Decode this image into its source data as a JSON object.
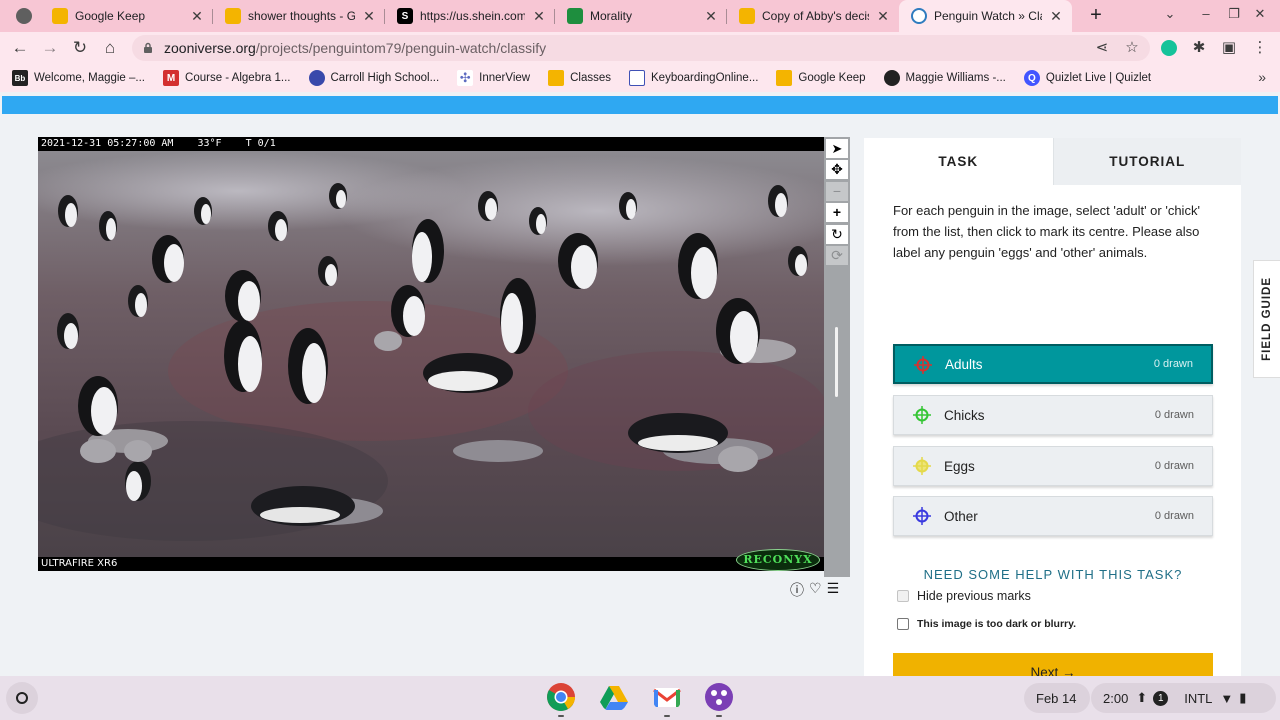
{
  "browser": {
    "tabs": [
      {
        "title": "Google Keep",
        "icon": "keep-icon",
        "color": "#f4b400",
        "active": false
      },
      {
        "title": "shower thoughts - Goo",
        "icon": "docs-icon",
        "color": "#f4b400",
        "active": false
      },
      {
        "title": "https://us.shein.com/a",
        "icon": "shein-icon",
        "color": "#000000",
        "active": false
      },
      {
        "title": "Morality",
        "icon": "classroom-icon",
        "color": "#1e8e3e",
        "active": false
      },
      {
        "title": "Copy of Abby's decisio",
        "icon": "slides-icon",
        "color": "#f4b400",
        "active": false
      },
      {
        "title": "Penguin Watch » Clas",
        "icon": "zooniverse-icon",
        "color": "#2f7cbf",
        "active": true
      }
    ],
    "url_host": "zooniverse.org",
    "url_path": "/projects/penguintom79/penguin-watch/classify",
    "bookmarks": [
      {
        "label": "Welcome, Maggie –...",
        "icon": "blackboard-icon",
        "color": "#222222",
        "glyph": "Bb"
      },
      {
        "label": "Course - Algebra 1...",
        "icon": "mcgraw-icon",
        "color": "#d32f2f",
        "glyph": "M"
      },
      {
        "label": "Carroll High School...",
        "icon": "school-icon",
        "color": "#3949ab",
        "glyph": ""
      },
      {
        "label": "InnerView",
        "icon": "innerview-icon",
        "color": "#5c6bc0",
        "glyph": ""
      },
      {
        "label": "Classes",
        "icon": "classroom-icon",
        "color": "#f4b400",
        "glyph": ""
      },
      {
        "label": "KeyboardingOnline...",
        "icon": "keyboarding-icon",
        "color": "#3f51b5",
        "glyph": ""
      },
      {
        "label": "Google Keep",
        "icon": "keep-icon",
        "color": "#f4b400",
        "glyph": ""
      },
      {
        "label": "Maggie Williams -...",
        "icon": "github-icon",
        "color": "#222222",
        "glyph": ""
      },
      {
        "label": "Quizlet Live | Quizlet",
        "icon": "quizlet-icon",
        "color": "#4255ff",
        "glyph": "Q"
      }
    ]
  },
  "viewer": {
    "timestamp": "2021-12-31 05:27:00 AM",
    "temperature": "33°F",
    "trigger": "T 0/1",
    "camera_model": "ULTRAFIRE XR6",
    "brand": "RECONYX"
  },
  "panel": {
    "tab_task": "TASK",
    "tab_tutorial": "TUTORIAL",
    "instructions": "For each penguin in the image, select 'adult' or 'chick' from the list, then click to mark its centre. Please also label any penguin 'eggs' and 'other' animals.",
    "options": [
      {
        "label": "Adults",
        "count": "0 drawn",
        "color": "#d7322f",
        "selected": true
      },
      {
        "label": "Chicks",
        "count": "0 drawn",
        "color": "#34c534",
        "selected": false
      },
      {
        "label": "Eggs",
        "count": "0 drawn",
        "color": "#e4d94a",
        "selected": false
      },
      {
        "label": "Other",
        "count": "0 drawn",
        "color": "#3a3adf",
        "selected": false
      }
    ],
    "help_link": "NEED SOME HELP WITH THIS TASK?",
    "hide_marks_label": "Hide previous marks",
    "too_dark_label": "This image is too dark or blurry.",
    "next_label": "Next →",
    "field_guide": "FIELD GUIDE"
  },
  "shelf": {
    "date": "Feb 14",
    "time": "2:00",
    "notification_count": "1",
    "keyboard": "INTL"
  }
}
